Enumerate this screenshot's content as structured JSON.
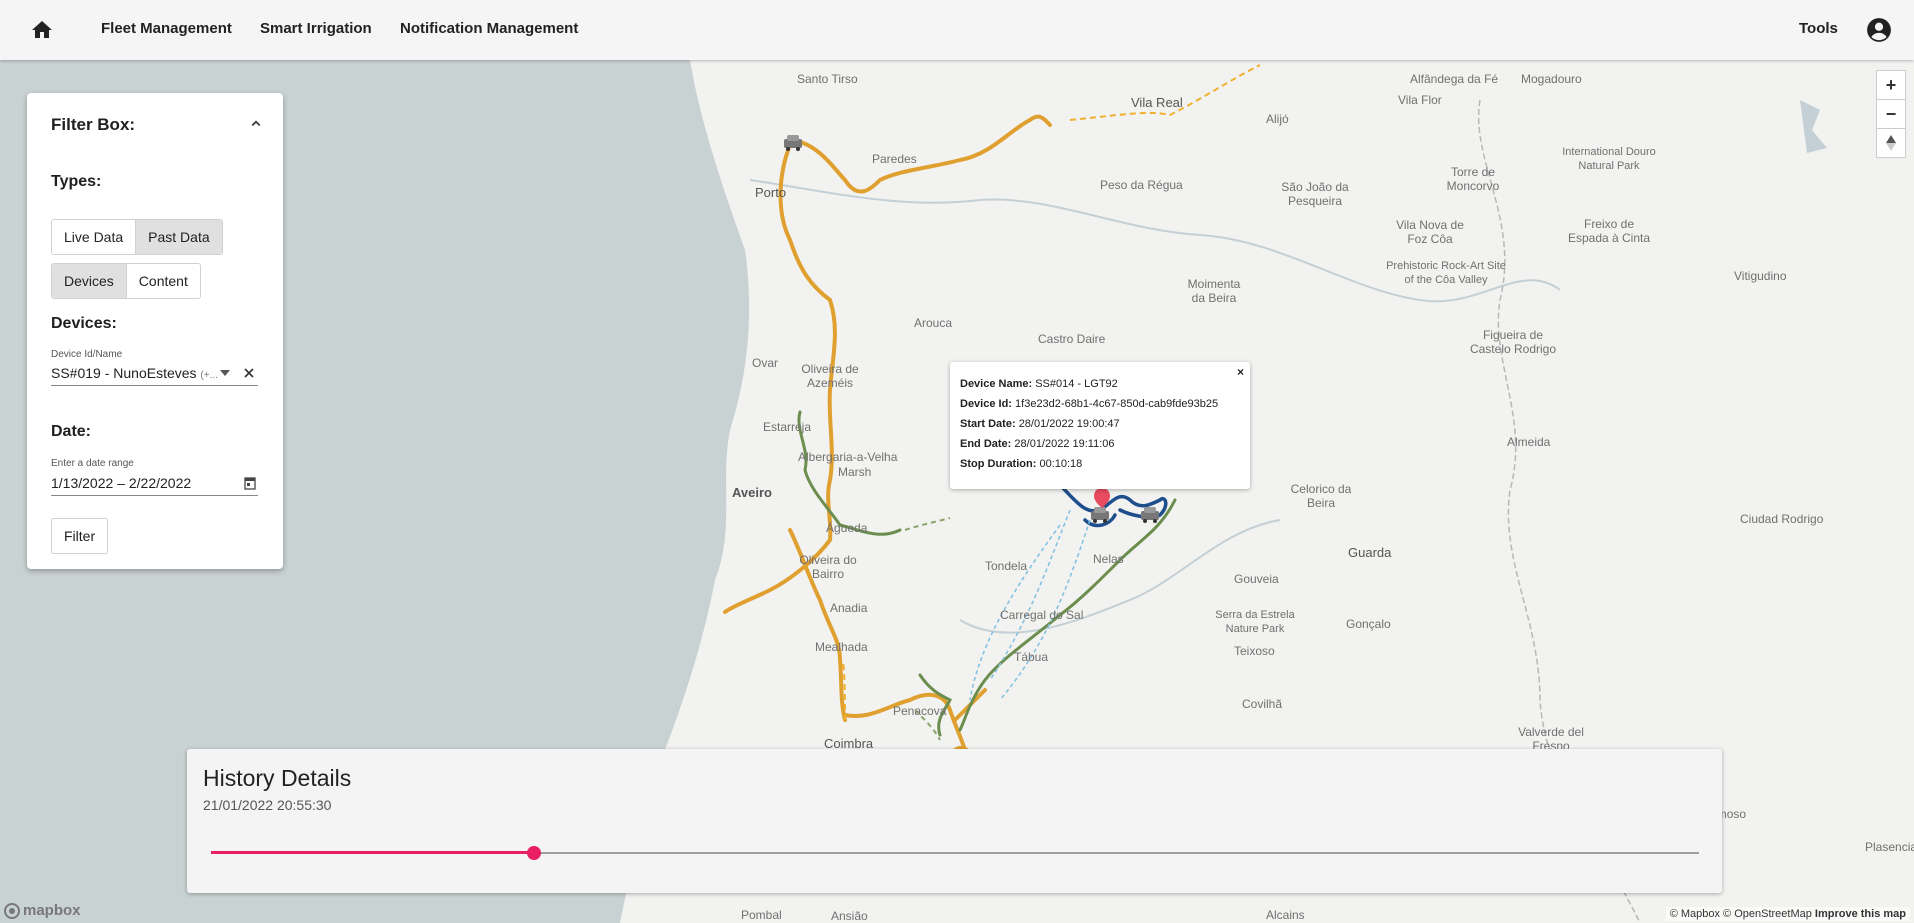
{
  "nav": {
    "items": [
      "Fleet Management",
      "Smart Irrigation",
      "Notification Management"
    ],
    "tools": "Tools"
  },
  "filter": {
    "title": "Filter Box:",
    "types_heading": "Types:",
    "type_options": [
      "Live Data",
      "Past Data"
    ],
    "type_selected": "Past Data",
    "source_options": [
      "Devices",
      "Content"
    ],
    "source_selected": "Devices",
    "devices_heading": "Devices:",
    "device_label": "Device Id/Name",
    "device_value": "SS#019 - NunoEsteves",
    "device_more": "(+...",
    "date_heading": "Date:",
    "date_label": "Enter a date range",
    "date_start": "1/13/2022",
    "date_sep": "–",
    "date_end": "2/22/2022",
    "filter_button": "Filter"
  },
  "popup": {
    "close": "×",
    "device_name_label": "Device Name:",
    "device_name": "SS#014 - LGT92",
    "device_id_label": "Device Id:",
    "device_id": "1f3e23d2-68b1-4c67-850d-cab9fde93b25",
    "start_label": "Start Date:",
    "start": "28/01/2022 19:00:47",
    "end_label": "End Date:",
    "end": "28/01/2022 19:11:06",
    "stop_label": "Stop Duration:",
    "stop": "00:10:18"
  },
  "history": {
    "title": "History Details",
    "timestamp": "21/01/2022 20:55:30",
    "slider_fraction": 0.217
  },
  "map": {
    "zoom_in": "+",
    "zoom_out": "−",
    "attribution": "© Mapbox © OpenStreetMap",
    "improve": "Improve this map",
    "logo": "mapbox",
    "places": [
      "Santo Tirso",
      "Vila Real",
      "Alfândega da Fé",
      "Mogadouro",
      "Vila Flor",
      "Alijó",
      "Paredes",
      "Porto",
      "Peso da Régua",
      "São João da Pesqueira",
      "Torre de Moncorvo",
      "International Douro Natural Park",
      "Vila Nova de Foz Côa",
      "Prehistoric Rock-Art Site of the Côa Valley",
      "Freixo de Espada à Cinta",
      "Vitigudino",
      "Moimenta da Beira",
      "Arouca",
      "Castro Daire",
      "Ovar",
      "Oliveira de Azeméis",
      "Figueira de Castelo Rodrigo",
      "Estarreja",
      "Albergaria-a-Velha",
      "Marsh",
      "Aveiro",
      "Almeida",
      "Celorico da Beira",
      "Águeda",
      "Ciudad Rodrigo",
      "Oliveira do Bairro",
      "Tondela",
      "Nelas",
      "Gouveia",
      "Guarda",
      "Anadia",
      "Serra da Estrela Nature Park",
      "Gonçalo",
      "Carregal do Sal",
      "Mealhada",
      "Tábua",
      "Teixoso",
      "Covilhã",
      "Penacova",
      "Valverde del Fresno",
      "Coimbra",
      "Montehermoso",
      "Plasencia",
      "Pombal",
      "Ansião",
      "Alcains"
    ],
    "colors": {
      "route_orange": "#e0a030",
      "route_green": "#6b8e4e",
      "route_blue": "#1e4e8c",
      "route_lightblue": "#7fc0e0",
      "sea": "#c9d2d3",
      "land": "#f2f2f0",
      "accent": "#e91e63",
      "marker": "#e84a5f"
    },
    "icons": [
      "car-marker-icon",
      "location-pin-icon"
    ]
  }
}
